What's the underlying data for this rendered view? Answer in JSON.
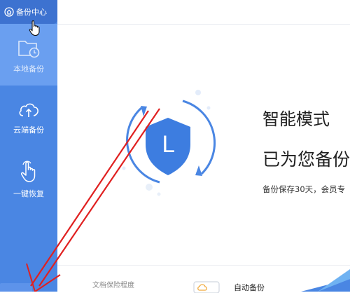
{
  "sidebar": {
    "top_tab": {
      "label": "备份中心",
      "icon": "home-icon"
    },
    "items": [
      {
        "label": "本地备份",
        "icon": "folder-clock-icon",
        "active": true
      },
      {
        "label": "云端备份",
        "icon": "cloud-upload-icon",
        "active": false
      },
      {
        "label": "一键恢复",
        "icon": "hand-pointer-icon",
        "active": false
      }
    ]
  },
  "main": {
    "mode_title": "智能模式",
    "status_heading": "已为您备份",
    "info_text": "备份保存30天，会员专",
    "shield_letter": "L",
    "doc_protection_label": "文档保险程度",
    "auto_backup_label": "自动备份"
  },
  "colors": {
    "sidebar_bg": "#4a86e3",
    "sidebar_top": "#3d72d0",
    "sidebar_active": "#6a9ff0",
    "accent_blue": "#4a86e3",
    "arrow_red": "#e02020"
  }
}
